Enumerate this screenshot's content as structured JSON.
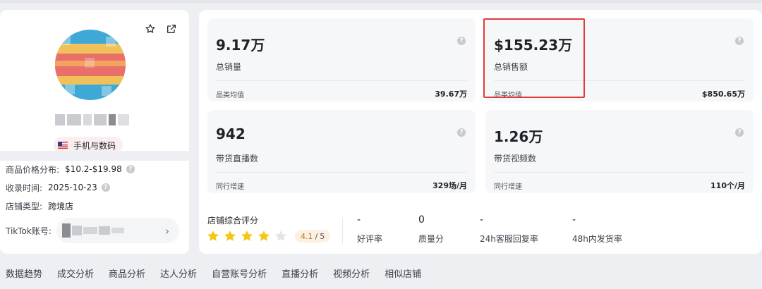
{
  "profile": {
    "category": "手机与数码",
    "info": [
      {
        "label": "商品价格分布:",
        "value": "$10.2-$19.98",
        "help": true
      },
      {
        "label": "收录时间:",
        "value": "2025-10-23",
        "help": true
      },
      {
        "label": "店铺类型:",
        "value": "跨境店",
        "help": false
      }
    ],
    "tiktok_label": "TikTok账号:"
  },
  "stats": [
    {
      "value": "9.17万",
      "label": "总销量",
      "foot_label": "品类均值",
      "foot_value": "39.67万"
    },
    {
      "value": "$155.23万",
      "label": "总销售额",
      "foot_label": "品类均值",
      "foot_value": "$850.65万"
    },
    {
      "value": "942",
      "label": "带货直播数",
      "foot_label": "同行增速",
      "foot_value": "329场/月"
    },
    {
      "value": "1.26万",
      "label": "带货视频数",
      "foot_label": "同行增速",
      "foot_value": "110个/月"
    }
  ],
  "score": {
    "title": "店铺综合评分",
    "rating": 4.1,
    "value": "4.1",
    "separator": "/",
    "max": "5",
    "star_colors": {
      "filled": "#f5c518",
      "empty": "#e3e4e8"
    }
  },
  "metrics": [
    {
      "value": "-",
      "label": "好评率"
    },
    {
      "value": "0",
      "label": "质量分"
    },
    {
      "value": "-",
      "label": "24h客服回复率"
    },
    {
      "value": "-",
      "label": "48h内发货率"
    }
  ],
  "tabs": [
    "数据趋势",
    "成交分析",
    "商品分析",
    "达人分析",
    "自营账号分析",
    "直播分析",
    "视频分析",
    "相似店铺"
  ],
  "colors": {
    "highlight": "#e03a3a",
    "badge_bg": "#fdf0e0"
  }
}
